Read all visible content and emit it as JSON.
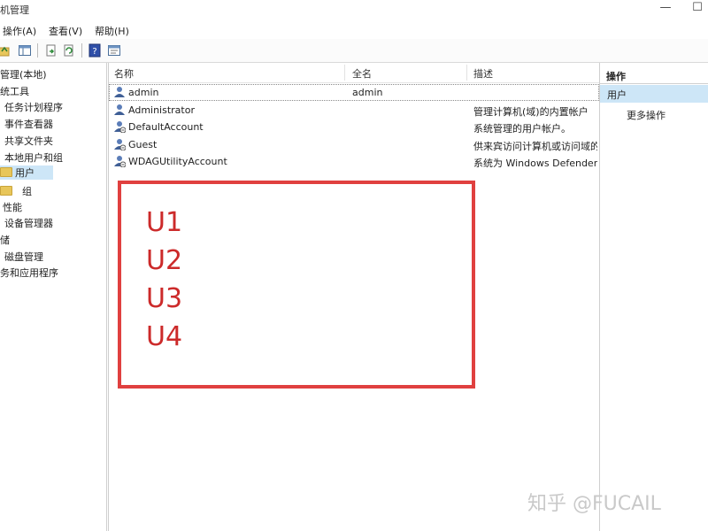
{
  "window": {
    "title": "机管理",
    "controls": {
      "minimize": "—",
      "maximize": "☐"
    }
  },
  "menu": [
    {
      "label": "操作(A)"
    },
    {
      "label": "查看(V)"
    },
    {
      "label": "帮助(H)"
    }
  ],
  "toolbar": {
    "icons": [
      "up-folder-icon",
      "show-tree-icon",
      "export-icon",
      "refresh-icon",
      "help-icon",
      "properties-icon"
    ]
  },
  "tree": {
    "items": [
      {
        "label": "管理(本地)"
      },
      {
        "label": "统工具"
      },
      {
        "label": "任务计划程序"
      },
      {
        "label": "事件查看器"
      },
      {
        "label": "共享文件夹"
      },
      {
        "label": "本地用户和组"
      },
      {
        "label": "用户"
      },
      {
        "label": "组"
      },
      {
        "label": "性能"
      },
      {
        "label": "设备管理器"
      },
      {
        "label": "储"
      },
      {
        "label": "磁盘管理"
      },
      {
        "label": "务和应用程序"
      }
    ]
  },
  "list": {
    "columns": [
      {
        "label": "名称"
      },
      {
        "label": "全名"
      },
      {
        "label": "描述"
      }
    ],
    "rows": [
      {
        "name": "admin",
        "fullname": "admin",
        "desc": ""
      },
      {
        "name": "Administrator",
        "fullname": "",
        "desc": "管理计算机(域)的内置帐户"
      },
      {
        "name": "DefaultAccount",
        "fullname": "",
        "desc": "系统管理的用户帐户。"
      },
      {
        "name": "Guest",
        "fullname": "",
        "desc": "供来宾访问计算机或访问域的"
      },
      {
        "name": "WDAGUtilityAccount",
        "fullname": "",
        "desc": "系统为 Windows Defender"
      }
    ]
  },
  "annotation": {
    "items": [
      "U1",
      "U2",
      "U3",
      "U4"
    ],
    "border_color": "#e0403f"
  },
  "actions": {
    "header": "操作",
    "selected": "用户",
    "more": "更多操作"
  },
  "watermark": "知乎 @FUCAIL"
}
